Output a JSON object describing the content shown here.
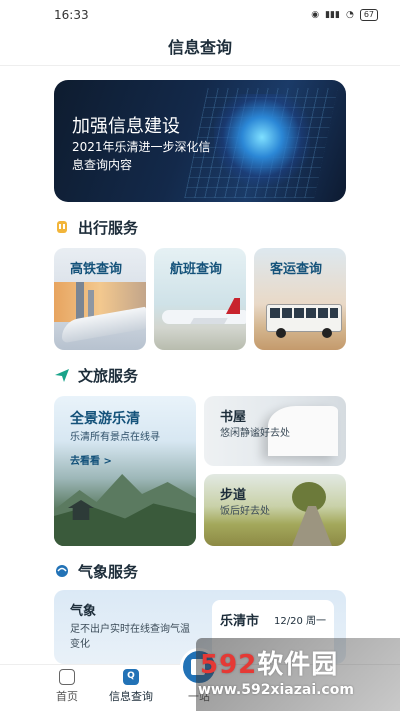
{
  "status_bar": {
    "time": "16:33",
    "battery": "67"
  },
  "header": {
    "title": "信息查询"
  },
  "banner": {
    "headline": "加强信息建设",
    "subline": "2021年乐清进一步深化信息查询内容"
  },
  "sections": {
    "travel": {
      "title": "出行服务"
    },
    "culture": {
      "title": "文旅服务"
    },
    "weather": {
      "title": "气象服务"
    }
  },
  "travel_cards": [
    {
      "label": "高铁查询"
    },
    {
      "label": "航班查询"
    },
    {
      "label": "客运查询"
    }
  ],
  "culture_cards": {
    "tour": {
      "label": "全景游乐清",
      "desc": "乐清所有景点在线寻",
      "link": "去看看 >"
    },
    "book": {
      "label": "书屋",
      "desc": "悠闲静谧好去处"
    },
    "walk": {
      "label": "步道",
      "desc": "饭后好去处"
    }
  },
  "weather_card": {
    "label": "气象",
    "desc": "足不出户实时在线查询气温变化",
    "city": "乐清市",
    "date": "12/20 周一"
  },
  "tabbar": [
    {
      "label": "首页"
    },
    {
      "label": "信息查询"
    },
    {
      "label": "一站"
    }
  ],
  "watermark": {
    "logo_a": "592",
    "logo_b": "软件园",
    "url": "www.592xiazai.com"
  },
  "colors": {
    "accent": "#2272b6",
    "card_label": "#14527a"
  },
  "icons": [
    "signal-icon",
    "wifi-icon",
    "battery-icon",
    "travel-icon",
    "culture-icon",
    "weather-icon",
    "home-icon",
    "query-icon"
  ]
}
